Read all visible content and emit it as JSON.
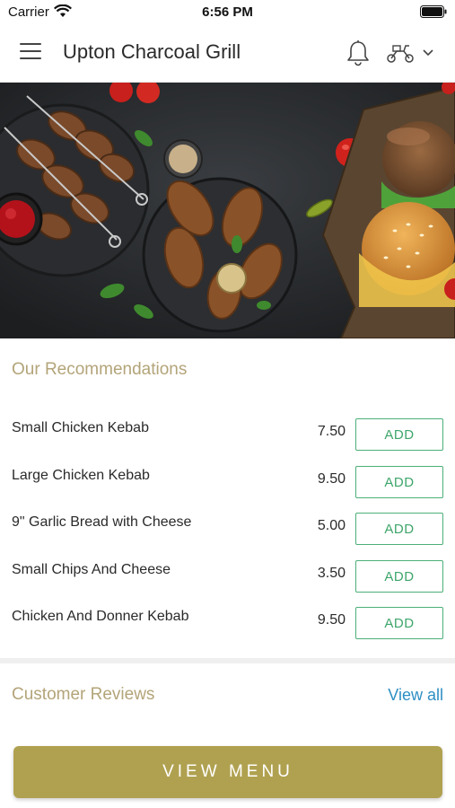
{
  "status_bar": {
    "carrier": "Carrier",
    "time": "6:56 PM"
  },
  "header": {
    "title": "Upton Charcoal Grill",
    "icons": [
      "menu-icon",
      "bell-icon",
      "scooter-icon",
      "chevron-down-icon"
    ]
  },
  "hero": {
    "icon": "food-hero-image"
  },
  "recommendations": {
    "title": "Our Recommendations",
    "items": [
      {
        "name": "Small Chicken Kebab",
        "price": "7.50",
        "button": "ADD"
      },
      {
        "name": "Large Chicken Kebab",
        "price": "9.50",
        "button": "ADD"
      },
      {
        "name": "9\" Garlic Bread with Cheese",
        "price": "5.00",
        "button": "ADD"
      },
      {
        "name": "Small Chips And Cheese",
        "price": "3.50",
        "button": "ADD"
      },
      {
        "name": "Chicken And Donner Kebab",
        "price": "9.50",
        "button": "ADD"
      }
    ]
  },
  "reviews": {
    "title": "Customer Reviews",
    "view_all": "View all"
  },
  "footer": {
    "button": "VIEW MENU"
  },
  "colors": {
    "accent_gold": "#b0a150",
    "section_title": "#b3a479",
    "add_green": "#3da56a",
    "link_blue": "#2d8fc4"
  }
}
